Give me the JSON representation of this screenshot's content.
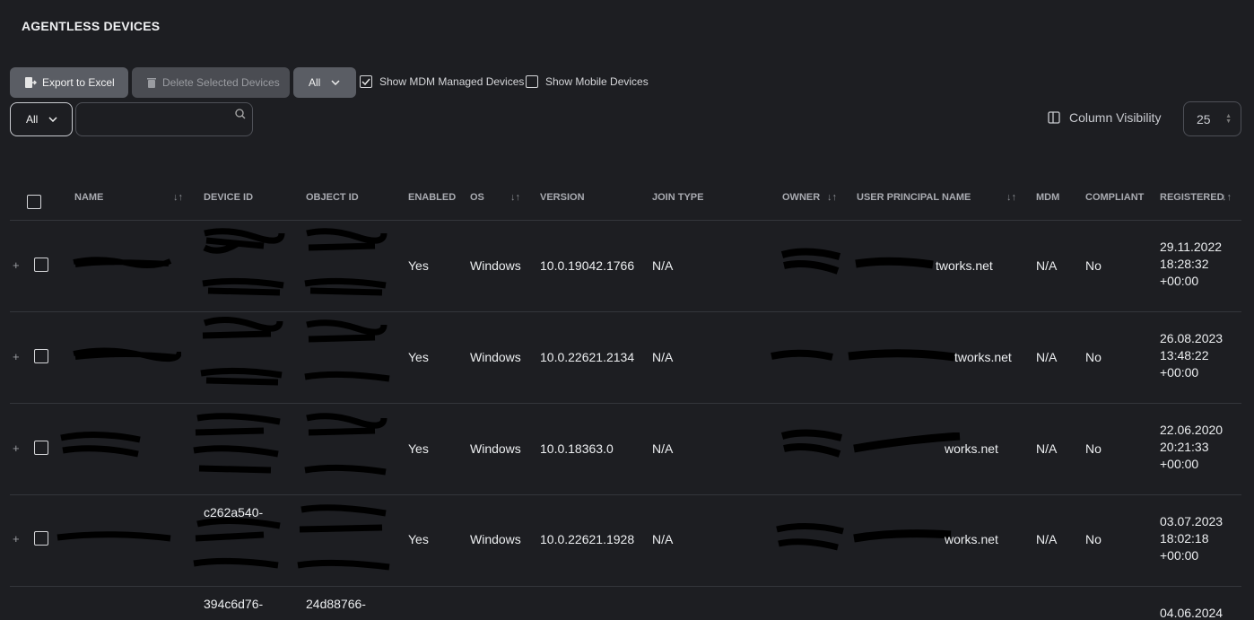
{
  "page": {
    "title": "AGENTLESS DEVICES"
  },
  "toolbar": {
    "export_label": "Export to Excel",
    "delete_label": "Delete Selected Devices",
    "filter_all": "All",
    "show_mdm_label": "Show MDM Managed Devices",
    "show_mdm_checked": true,
    "show_mobile_label": "Show Mobile Devices",
    "show_mobile_checked": false,
    "filter2_all": "All",
    "search_value": "",
    "column_visibility_label": "Column Visibility",
    "page_size": "25"
  },
  "table": {
    "headers": {
      "name": "NAME",
      "device_id": "DEVICE ID",
      "object_id": "OBJECT ID",
      "enabled": "ENABLED",
      "os": "OS",
      "version": "VERSION",
      "join_type": "JOIN TYPE",
      "owner": "OWNER",
      "upn": "USER PRINCIPAL NAME",
      "mdm": "MDM",
      "compliant": "COMPLIANT",
      "registered": "REGISTERED"
    },
    "rows": [
      {
        "enabled": "Yes",
        "os": "Windows",
        "version": "10.0.19042.1766",
        "join_type": "N/A",
        "upn_suffix": "tworks.net",
        "mdm": "N/A",
        "compliant": "No",
        "reg_date": "29.11.2022",
        "reg_time": "18:28:32",
        "reg_tz": "+00:00"
      },
      {
        "enabled": "Yes",
        "os": "Windows",
        "version": "10.0.22621.2134",
        "join_type": "N/A",
        "upn_suffix": "tworks.net",
        "mdm": "N/A",
        "compliant": "No",
        "reg_date": "26.08.2023",
        "reg_time": "13:48:22",
        "reg_tz": "+00:00"
      },
      {
        "enabled": "Yes",
        "os": "Windows",
        "version": "10.0.18363.0",
        "join_type": "N/A",
        "upn_suffix": "works.net",
        "mdm": "N/A",
        "compliant": "No",
        "reg_date": "22.06.2020",
        "reg_time": "20:21:33",
        "reg_tz": "+00:00"
      },
      {
        "enabled": "Yes",
        "os": "Windows",
        "version": "10.0.22621.1928",
        "join_type": "N/A",
        "upn_suffix": "works.net",
        "mdm": "N/A",
        "compliant": "No",
        "reg_date": "03.07.2023",
        "reg_time": "18:02:18",
        "reg_tz": "+00:00"
      },
      {
        "device_id_partial": "394c6d76-",
        "object_id_partial": "24d88766-",
        "reg_date": "04.06.2024"
      }
    ]
  }
}
